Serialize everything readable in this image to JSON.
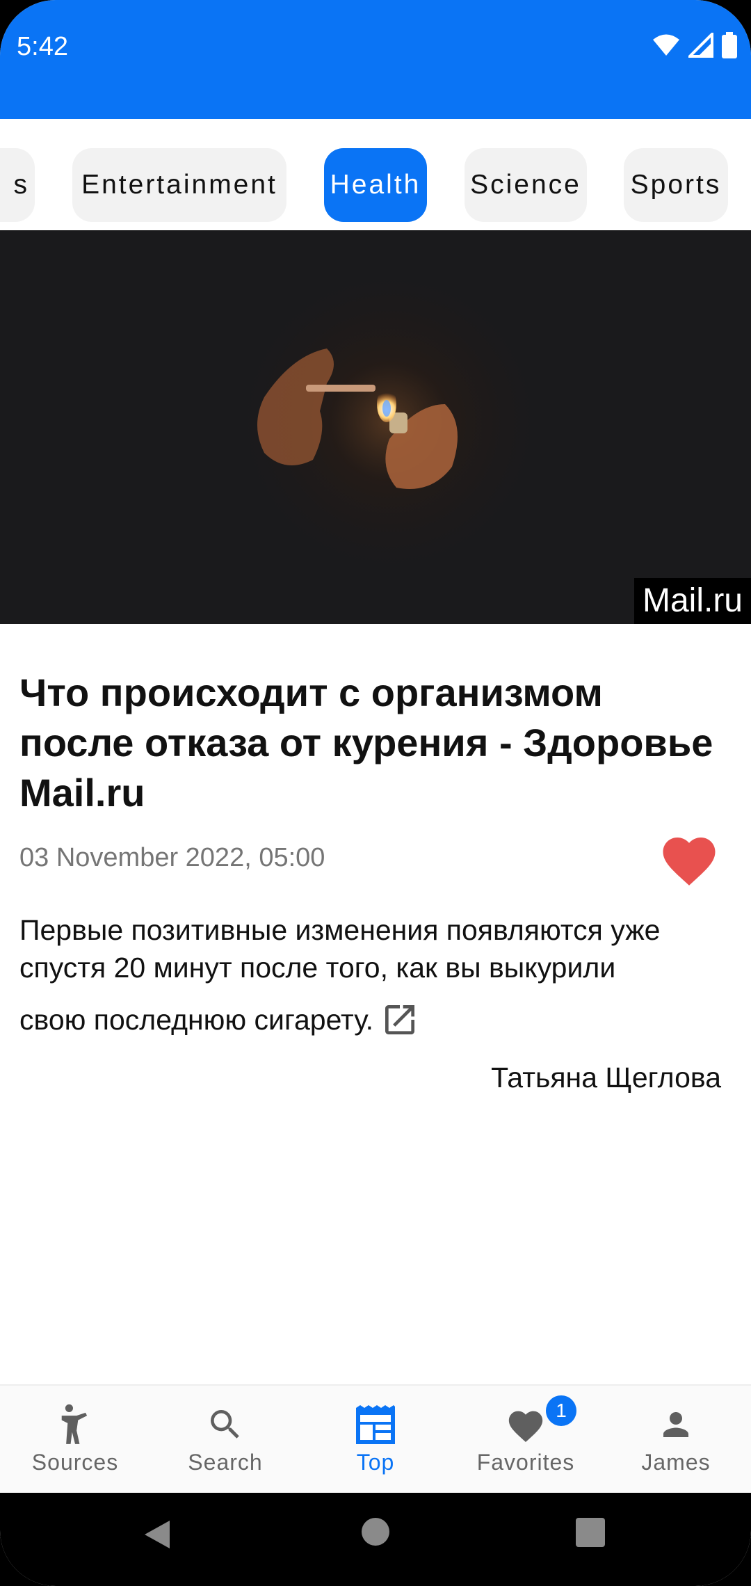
{
  "status_bar": {
    "time": "5:42",
    "color": "#0a74f5"
  },
  "categories": [
    {
      "label": "s",
      "active": false
    },
    {
      "label": "Entertainment",
      "active": false
    },
    {
      "label": "Health",
      "active": true
    },
    {
      "label": "Science",
      "active": false
    },
    {
      "label": "Sports",
      "active": false
    }
  ],
  "article": {
    "image_credit": "Mail.ru",
    "title": "Что происходит с организмом после отказа от курения - Здоровье Mail.ru",
    "date": "03 November 2022, 05:00",
    "summary_line1": "Первые позитивные изменения появляются уже",
    "summary_line2": "спустя 20 минут после того, как вы выкурили",
    "summary_line3": "свою последнюю сигарету.",
    "author": "Татьяна Щеглова",
    "favorite": true,
    "icons": {
      "favorite": "heart-icon",
      "open_link": "open-in-new-icon"
    }
  },
  "bottom_nav": {
    "items": [
      {
        "label": "Sources",
        "icon": "person-icon",
        "active": false
      },
      {
        "label": "Search",
        "icon": "search-icon",
        "active": false
      },
      {
        "label": "Top",
        "icon": "newspaper-icon",
        "active": true
      },
      {
        "label": "Favorites",
        "icon": "heart-icon",
        "active": false,
        "badge": "1"
      },
      {
        "label": "James",
        "icon": "account-icon",
        "active": false
      }
    ]
  },
  "colors": {
    "accent": "#0a74f5",
    "favorite": "#e8514f"
  }
}
